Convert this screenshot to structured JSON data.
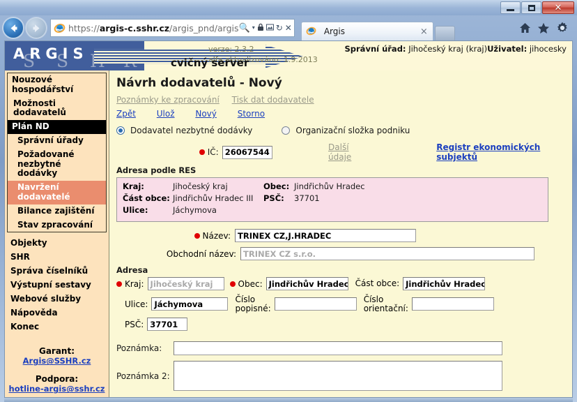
{
  "window": {
    "minimize_label": "Minimize",
    "maximize_label": "Maximize",
    "close_label": "Close"
  },
  "browser": {
    "back_label": "←",
    "forward_label": "→",
    "url_prefix": "https://",
    "url_domain": "argis-c.sshr.cz",
    "url_path": "/argis_pnd/argis",
    "tab_title": "Argis",
    "tab_close_label": "×",
    "icons": {
      "search": "search-icon",
      "dropdown": "▾",
      "lock": "🔒",
      "compat": "compatibility-icon",
      "refresh": "↻",
      "stop": "✕",
      "home": "home-icon",
      "favorites": "favorites-star-icon",
      "settings": "gear-icon"
    }
  },
  "header": {
    "logo": "ARGIS",
    "watermark": "SSHR",
    "verze": "verze: 2.3.2",
    "alfa": "alfa aktualizováno: 1.9.2013",
    "cvicny": "cvičný server",
    "urad_label": "Správní úřad:",
    "urad_value": "Jihočeský kraj (kraj)",
    "user_label": "Uživatel:",
    "user_value": "jihocesky"
  },
  "sidebar": {
    "group_title": "Nouzové hospodářství",
    "item_moznosti": "Možnosti dodavatelů",
    "item_plan": "Plán ND",
    "sub_spravni": "Správní úřady",
    "sub_pozadovane": "Požadované nezbytné dodávky",
    "sub_navrzeni": "Navržení dodavatelé",
    "sub_bilance": "Bilance zajištění",
    "sub_stav": "Stav zpracování",
    "flat": [
      {
        "label": "Objekty"
      },
      {
        "label": "SHR"
      },
      {
        "label": "Správa číselníků"
      },
      {
        "label": "Výstupní sestavy"
      },
      {
        "label": "Webové služby"
      },
      {
        "label": "Nápověda"
      },
      {
        "label": "Konec"
      }
    ],
    "garant_label": "Garant:",
    "garant_mail": "Argis@SSHR.cz",
    "podpora_label": "Podpora:",
    "podpora_mail": "hotline-argis@sshr.cz"
  },
  "main": {
    "page_title": "Návrh dodavatelů - Nový",
    "link_poznamky": "Poznámky ke zpracování",
    "link_tisk": "Tisk dat dodavatele",
    "action_zpet": "Zpět",
    "action_uloz": "Ulož",
    "action_novy": "Nový",
    "action_storno": "Storno",
    "radio_dodavatel": "Dodavatel nezbytné dodávky",
    "radio_organizacni": "Organizační složka podniku",
    "ic_label": "IČ:",
    "ic_value": "26067544",
    "link_dalsi": "Další údaje",
    "link_registr": "Registr ekonomických subjektů",
    "res_title": "Adresa podle RES",
    "res": {
      "kraj_label": "Kraj:",
      "kraj_value": "Jihočeský kraj",
      "obec_label": "Obec:",
      "obec_value": "Jindřichův Hradec",
      "cast_label": "Část obce:",
      "cast_value": "Jindřichův Hradec III",
      "psc_label": "PSČ:",
      "psc_value": "37701",
      "ulice_label": "Ulice:",
      "ulice_value": "Jáchymova"
    },
    "nazev_label": "Název:",
    "nazev_value": "TRINEX CZ,J.HRADEC",
    "obchodni_label": "Obchodní název:",
    "obchodni_value": "TRINEX CZ s.r.o.",
    "adresa_title": "Adresa",
    "adr": {
      "kraj_label": "Kraj:",
      "kraj_value": "Jihočeský kraj",
      "obec_label": "Obec:",
      "obec_value": "Jindřichův Hradec",
      "cast_label": "Část obce:",
      "cast_value": "Jindřichův Hradec I",
      "ulice_label": "Ulice:",
      "ulice_value": "Jáchymova",
      "cp_label_1": "Číslo",
      "cp_label_2": "popisné:",
      "cp_value": "",
      "co_label_1": "Číslo",
      "co_label_2": "orientační:",
      "co_value": "",
      "psc_label": "PSČ:",
      "psc_value": "37701"
    },
    "poznamka_label": "Poznámka:",
    "poznamka_value": "",
    "poznamka2_label": "Poznámka 2:",
    "poznamka2_value": ""
  }
}
